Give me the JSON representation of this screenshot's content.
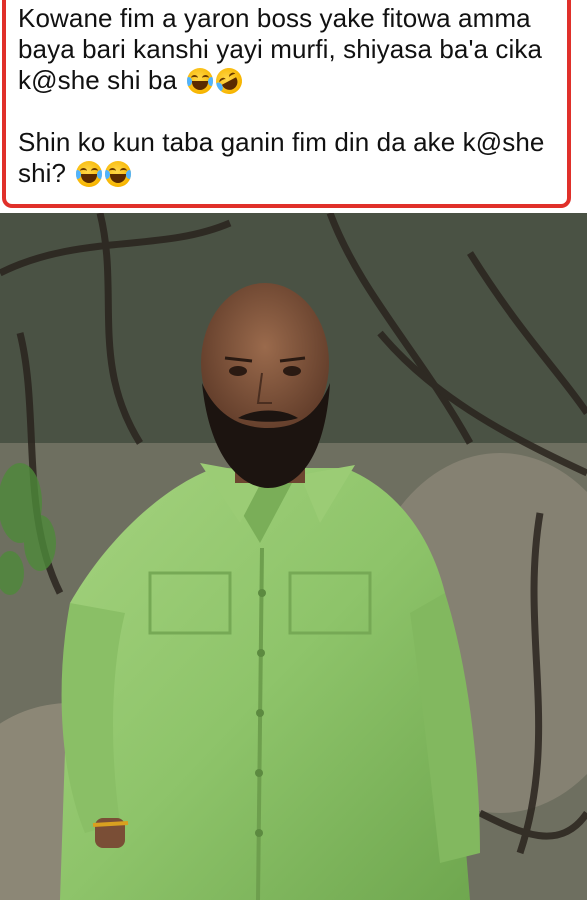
{
  "caption": {
    "line1": "Kowane fim a yaron boss yake fitowa amma",
    "line2": "baya bari kanshi yayi murfi, shiyasa ba'a cika",
    "line3": "k@she shi ba",
    "line4": "Shin ko kun taba ganin fim din da ake k@she",
    "line5": "shi?"
  },
  "emojis": [
    "joy-emoji",
    "rofl-emoji",
    "joy-emoji",
    "joy-emoji"
  ],
  "colors": {
    "border": "#e0302a",
    "shirt": "#8ec46a"
  }
}
